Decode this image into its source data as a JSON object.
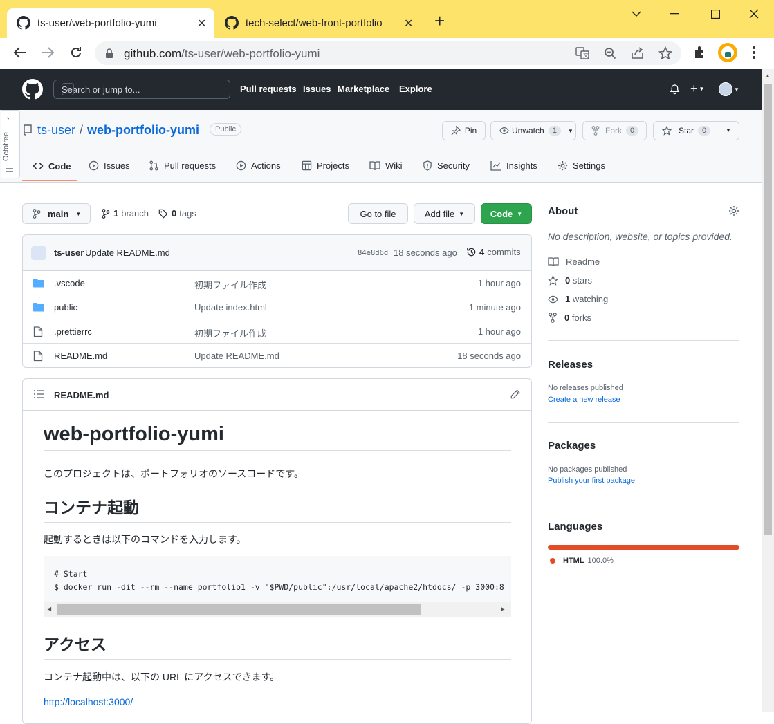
{
  "browser": {
    "tabs": [
      {
        "title": "ts-user/web-portfolio-yumi",
        "close": "✕"
      },
      {
        "title": "tech-select/web-front-portfolio",
        "close": "✕"
      }
    ],
    "new_tab": "+",
    "url_host": "github.com",
    "url_path": "/ts-user/web-portfolio-yumi"
  },
  "github": {
    "search_placeholder": "Search or jump to...",
    "search_key": "/",
    "nav": [
      "Pull requests",
      "Issues",
      "Marketplace",
      "Explore"
    ]
  },
  "repo": {
    "owner": "ts-user",
    "sep": "/",
    "name": "web-portfolio-yumi",
    "visibility": "Public",
    "pin": "Pin",
    "unwatch": "Unwatch",
    "watch_count": "1",
    "fork": "Fork",
    "fork_count": "0",
    "star": "Star",
    "star_count": "0",
    "tabs": [
      "Code",
      "Issues",
      "Pull requests",
      "Actions",
      "Projects",
      "Wiki",
      "Security",
      "Insights",
      "Settings"
    ]
  },
  "octotree": {
    "label": "Octotree"
  },
  "branchbar": {
    "branch": "main",
    "branch_count": "1",
    "branch_word": "branch",
    "tag_count": "0",
    "tag_word": "tags",
    "go_to_file": "Go to file",
    "add_file": "Add file",
    "code": "Code"
  },
  "commit": {
    "author": "ts-user",
    "message": "Update README.md",
    "sha": "84e8d6d",
    "age": "18 seconds ago",
    "count": "4",
    "count_word": "commits"
  },
  "files": [
    {
      "type": "dir",
      "name": ".vscode",
      "message": "初期ファイル作成",
      "age": "1 hour ago"
    },
    {
      "type": "dir",
      "name": "public",
      "message": "Update index.html",
      "age": "1 minute ago"
    },
    {
      "type": "file",
      "name": ".prettierrc",
      "message": "初期ファイル作成",
      "age": "1 hour ago"
    },
    {
      "type": "file",
      "name": "README.md",
      "message": "Update README.md",
      "age": "18 seconds ago"
    }
  ],
  "readme": {
    "filename": "README.md",
    "h1": "web-portfolio-yumi",
    "p1": "このプロジェクトは、ポートフォリオのソースコードです。",
    "h2a": "コンテナ起動",
    "p2": "起動するときは以下のコマンドを入力します。",
    "code_line1": "# Start",
    "code_line2": "$ docker run -dit --rm --name portfolio1 -v \"$PWD/public\":/usr/local/apache2/htdocs/ -p 3000:8",
    "h2b": "アクセス",
    "p3": "コンテナ起動中は、以下の URL にアクセスできます。",
    "link": "http://localhost:3000/"
  },
  "about": {
    "title": "About",
    "description": "No description, website, or topics provided.",
    "readme": "Readme",
    "stars": "0",
    "stars_word": "stars",
    "watching": "1",
    "watching_word": "watching",
    "forks": "0",
    "forks_word": "forks"
  },
  "releases": {
    "title": "Releases",
    "empty": "No releases published",
    "link": "Create a new release"
  },
  "packages": {
    "title": "Packages",
    "empty": "No packages published",
    "link": "Publish your first package"
  },
  "languages": {
    "title": "Languages",
    "items": [
      {
        "name": "HTML",
        "percent": "100.0%",
        "color": "#e34c26"
      }
    ]
  }
}
